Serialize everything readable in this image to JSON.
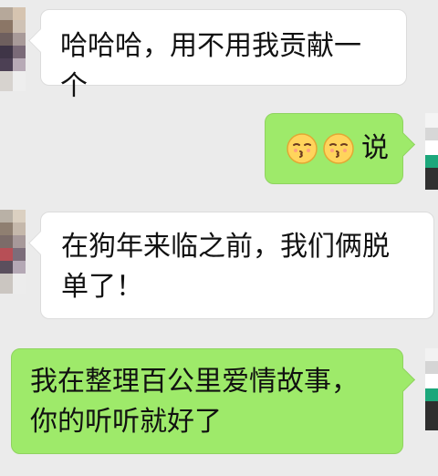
{
  "chat": {
    "messages": [
      {
        "side": "left",
        "text": "哈哈哈，用不用我贡献一个"
      },
      {
        "side": "right",
        "emoji": [
          "kissing-face",
          "kissing-face"
        ],
        "text": "说"
      },
      {
        "side": "left",
        "text": "在狗年来临之前，我们俩脱\n单了！"
      },
      {
        "side": "right",
        "text": "我在整理百公里爱情故事，\n你的听听就好了"
      }
    ]
  },
  "colors": {
    "background": "#ebebeb",
    "left_bubble": "#ffffff",
    "right_bubble": "#9eea6a",
    "text": "#111111"
  }
}
